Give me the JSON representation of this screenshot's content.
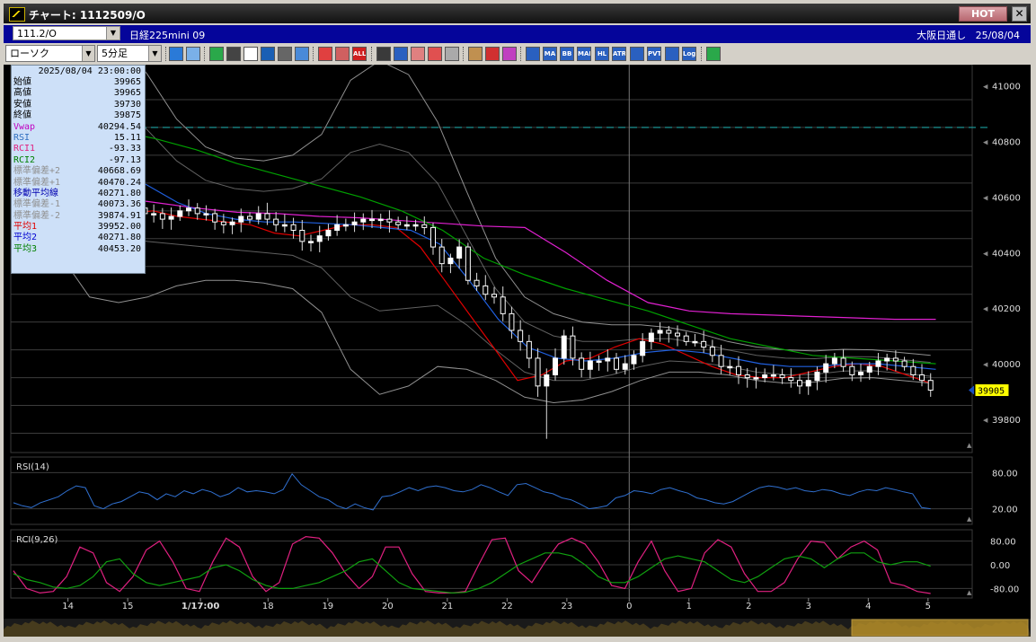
{
  "window": {
    "title": "チャート: 1112509/O",
    "hot_label": "HOT",
    "close_label": "✕"
  },
  "infobar": {
    "symbol": "111.2/O",
    "name": "日経225mini 09",
    "session": "大阪日通し",
    "date": "25/08/04"
  },
  "toolbar": {
    "chart_type": "ローソク",
    "timeframe": "5分足",
    "buttons": [
      {
        "name": "search-icon",
        "label": "",
        "color": "#2a7ad8"
      },
      {
        "name": "layout-icon",
        "label": "",
        "color": "#7ab0e8"
      },
      {
        "name": "trendline-icon",
        "label": "",
        "color": "#2aa84a"
      },
      {
        "name": "pen-icon",
        "label": "",
        "color": "#444444"
      },
      {
        "name": "cursor-icon",
        "label": "",
        "color": "#ffffff"
      },
      {
        "name": "arrow-icon",
        "label": "",
        "color": "#1a5fb4"
      },
      {
        "name": "copy-icon",
        "label": "",
        "color": "#666666"
      },
      {
        "name": "trash-icon",
        "label": "",
        "color": "#4a8ad8"
      },
      {
        "name": "candle-red-icon",
        "label": "",
        "color": "#e04040"
      },
      {
        "name": "candle-icon",
        "label": "",
        "color": "#d06060"
      },
      {
        "name": "all-button",
        "label": "ALL",
        "color": "#d02020"
      },
      {
        "name": "bull-icon",
        "label": "",
        "color": "#3a3a3a"
      },
      {
        "name": "zoom-icon",
        "label": "",
        "color": "#2a60c0"
      },
      {
        "name": "bars-icon",
        "label": "",
        "color": "#e08080"
      },
      {
        "name": "plus-minus-icon",
        "label": "",
        "color": "#e05050"
      },
      {
        "name": "disabled-icon",
        "label": "",
        "color": "#aaaaaa"
      },
      {
        "name": "grid-icon",
        "label": "",
        "color": "#c09050"
      },
      {
        "name": "tools-icon",
        "label": "",
        "color": "#d03030"
      },
      {
        "name": "palette-icon",
        "label": "",
        "color": "#c040c0"
      },
      {
        "name": "ichimoku-icon",
        "label": "",
        "color": "#2a60c0"
      },
      {
        "name": "ma-button",
        "label": "MA",
        "color": "#2a60c0"
      },
      {
        "name": "bb-button",
        "label": "BB",
        "color": "#2a60c0"
      },
      {
        "name": "mae-button",
        "label": "MAE",
        "color": "#2a60c0"
      },
      {
        "name": "hl-button",
        "label": "HL",
        "color": "#2a60c0"
      },
      {
        "name": "atr-button",
        "label": "ATR",
        "color": "#2a60c0"
      },
      {
        "name": "kagi-icon",
        "label": "",
        "color": "#2a60c0"
      },
      {
        "name": "pvt-button",
        "label": "PVT",
        "color": "#2a60c0"
      },
      {
        "name": "box-icon",
        "label": "",
        "color": "#2a60c0"
      },
      {
        "name": "log-button",
        "label": "Log",
        "color": "#2a60c0"
      },
      {
        "name": "settings-icon",
        "label": "",
        "color": "#2aa84a"
      }
    ]
  },
  "databox": {
    "datetime": "2025/08/04 23:00:00",
    "rows": [
      {
        "k": "始値",
        "v": "39965",
        "c": "#000000"
      },
      {
        "k": "高値",
        "v": "39965",
        "c": "#000000"
      },
      {
        "k": "安値",
        "v": "39730",
        "c": "#000000"
      },
      {
        "k": "終値",
        "v": "39875",
        "c": "#000000"
      },
      {
        "k": "Vwap",
        "v": "40294.54",
        "c": "#c000c0"
      },
      {
        "k": "RSI",
        "v": "15.11",
        "c": "#3070c0"
      },
      {
        "k": "RCI1",
        "v": "-93.33",
        "c": "#e02080"
      },
      {
        "k": "RCI2",
        "v": "-97.13",
        "c": "#008000"
      },
      {
        "k": "標準偏差+2",
        "v": "40668.69",
        "c": "#909090"
      },
      {
        "k": "標準偏差+1",
        "v": "40470.24",
        "c": "#909090"
      },
      {
        "k": "移動平均線",
        "v": "40271.80",
        "c": "#0000b0"
      },
      {
        "k": "標準偏差-1",
        "v": "40073.36",
        "c": "#909090"
      },
      {
        "k": "標準偏差-2",
        "v": "39874.91",
        "c": "#909090"
      },
      {
        "k": "平均1",
        "v": "39952.00",
        "c": "#e00000"
      },
      {
        "k": "平均2",
        "v": "40271.80",
        "c": "#0000d0"
      },
      {
        "k": "平均3",
        "v": "40453.20",
        "c": "#008000"
      }
    ]
  },
  "chart_data": [
    {
      "type": "candlestick",
      "title": "",
      "ylim": [
        39700,
        41050
      ],
      "y_ticks": [
        39800,
        40000,
        40200,
        40400,
        40600,
        40800,
        41000
      ],
      "x_ticks": [
        "14",
        "15",
        "1/17:00",
        "18",
        "19",
        "20",
        "21",
        "22",
        "23",
        "0",
        "1",
        "2",
        "3",
        "4",
        "5"
      ],
      "x_tick_pos": [
        2.2,
        4.5,
        7.3,
        9.9,
        12.2,
        14.5,
        16.8,
        19.1,
        21.4,
        23.8,
        26.1,
        28.4,
        30.7,
        33.0,
        35.3
      ],
      "x_count": 37,
      "session_divider_x": 23.8,
      "reference_line": 40850,
      "last_price": "39905",
      "close": [
        40820,
        40840,
        40860,
        40860,
        40850,
        40660,
        40560,
        40520,
        40540,
        40500,
        40540,
        40560,
        40560,
        40540,
        40540,
        40520,
        40530,
        40550,
        40560,
        40540,
        40540,
        40510,
        40500,
        40510,
        40530,
        40520,
        40540,
        40520,
        40500,
        40500,
        40480,
        40440,
        40440,
        40460,
        40480,
        40500,
        40500,
        40510,
        40520,
        40520,
        40520,
        40510,
        40500,
        40500,
        40500,
        40490,
        40420,
        40360,
        40380,
        40420,
        40300,
        40280,
        40250,
        40240,
        40180,
        40120,
        40080,
        40020,
        39920,
        39960,
        40020,
        40100,
        40020,
        39980,
        40010,
        40010,
        40020,
        39980,
        40000,
        40030,
        40080,
        40110,
        40120,
        40110,
        40100,
        40080,
        40080,
        40060,
        40030,
        39990,
        39990,
        39960,
        39950,
        39950,
        39960,
        39960,
        39950,
        39940,
        39920,
        39940,
        39970,
        40000,
        40020,
        39990,
        39960,
        39970,
        39990,
        40010,
        40020,
        40010,
        39990,
        39960,
        39940,
        39905
      ],
      "series": [
        {
          "name": "Vwap",
          "color": "#e020d0",
          "values": [
            40880,
            40760,
            40600,
            40580,
            40560,
            40545,
            40540,
            40530,
            40525,
            40515,
            40505,
            40495,
            40490,
            40400,
            40300,
            40220,
            40190,
            40180,
            40175,
            40170,
            40165,
            40160,
            40160
          ]
        },
        {
          "name": "平均1",
          "color": "#e00000",
          "values": [
            40830,
            40850,
            40600,
            40540,
            40540,
            40550,
            40530,
            40520,
            40510,
            40500,
            40470,
            40460,
            40480,
            40500,
            40500,
            40490,
            40420,
            40300,
            40180,
            40060,
            39940,
            39960,
            40010,
            40020,
            40060,
            40090,
            40070,
            40030,
            39990,
            39960,
            39950,
            39950,
            39970,
            39990,
            40000,
            39990,
            39960,
            39930
          ]
        },
        {
          "name": "平均2",
          "color": "#2060e0",
          "values": [
            40820,
            40830,
            40760,
            40700,
            40640,
            40580,
            40540,
            40520,
            40510,
            40510,
            40505,
            40500,
            40490,
            40480,
            40430,
            40300,
            40160,
            40060,
            40020,
            40010,
            40020,
            40040,
            40050,
            40040,
            40020,
            40000,
            39990,
            39990,
            40000,
            40000,
            39990,
            39980
          ]
        },
        {
          "name": "平均3",
          "color": "#00a000",
          "values": [
            40870,
            40860,
            40840,
            40810,
            40770,
            40720,
            40680,
            40640,
            40600,
            40550,
            40480,
            40380,
            40320,
            40270,
            40230,
            40190,
            40140,
            40090,
            40060,
            40030,
            40020,
            40010,
            40000
          ]
        }
      ],
      "bands": {
        "name": "標準偏差",
        "color": "#a0a0a0"
      }
    },
    {
      "type": "line",
      "title": "RSI(14)",
      "ylim": [
        0,
        100
      ],
      "y_ticks": [
        "80.00",
        "20.00"
      ],
      "series": [
        {
          "name": "RSI",
          "color": "#3070d0",
          "values": [
            30,
            25,
            22,
            30,
            35,
            40,
            50,
            58,
            55,
            25,
            20,
            28,
            32,
            40,
            48,
            45,
            35,
            45,
            40,
            50,
            45,
            52,
            48,
            40,
            45,
            55,
            48,
            50,
            48,
            45,
            52,
            78,
            60,
            50,
            40,
            35,
            25,
            20,
            28,
            22,
            18,
            40,
            42,
            48,
            55,
            50,
            56,
            58,
            55,
            50,
            48,
            52,
            60,
            55,
            48,
            42,
            60,
            62,
            55,
            48,
            45,
            38,
            35,
            28,
            20,
            22,
            25,
            38,
            42,
            50,
            48,
            45,
            52,
            55,
            50,
            46,
            38,
            35,
            30,
            28,
            32,
            40,
            48,
            55,
            58,
            56,
            52,
            55,
            50,
            48,
            52,
            50,
            45,
            42,
            48,
            52,
            50,
            55,
            52,
            48,
            45,
            22,
            20
          ]
        }
      ]
    },
    {
      "type": "line",
      "title": "RCI(9,26)",
      "ylim": [
        -100,
        100
      ],
      "y_ticks": [
        "80.00",
        "0.00",
        "-80.00"
      ],
      "series": [
        {
          "name": "RCI1",
          "color": "#e02080",
          "values": [
            -20,
            -80,
            -95,
            -90,
            -40,
            60,
            40,
            -60,
            -90,
            -40,
            50,
            80,
            10,
            -80,
            -90,
            10,
            90,
            60,
            -40,
            -90,
            -60,
            70,
            95,
            90,
            40,
            -30,
            -80,
            -40,
            60,
            60,
            -30,
            -90,
            -95,
            -95,
            -90,
            0,
            85,
            90,
            -20,
            -60,
            10,
            70,
            90,
            70,
            10,
            -70,
            -80,
            10,
            80,
            -20,
            -90,
            -80,
            40,
            85,
            60,
            -30,
            -90,
            -90,
            -60,
            20,
            80,
            75,
            20,
            60,
            80,
            50,
            -60,
            -70,
            -90,
            -97
          ]
        },
        {
          "name": "RCI2",
          "color": "#10a010",
          "values": [
            -30,
            -50,
            -60,
            -75,
            -80,
            -70,
            -40,
            10,
            20,
            -30,
            -60,
            -70,
            -60,
            -50,
            -40,
            -10,
            0,
            -20,
            -50,
            -70,
            -80,
            -80,
            -70,
            -60,
            -40,
            -20,
            10,
            20,
            -20,
            -60,
            -80,
            -85,
            -90,
            -95,
            -93,
            -80,
            -60,
            -30,
            0,
            20,
            40,
            40,
            30,
            0,
            -40,
            -60,
            -60,
            -40,
            -10,
            20,
            30,
            20,
            10,
            -20,
            -50,
            -60,
            -40,
            -10,
            20,
            30,
            20,
            -10,
            20,
            40,
            40,
            10,
            0,
            10,
            10,
            -5
          ]
        }
      ]
    }
  ]
}
